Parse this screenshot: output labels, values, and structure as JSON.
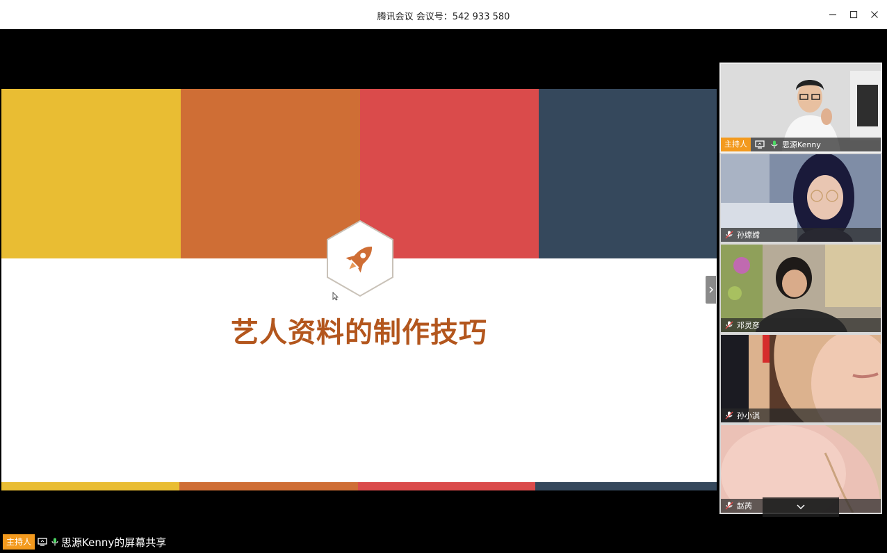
{
  "window": {
    "title": "腾讯会议 会议号：542 933 580",
    "minimize": "—",
    "maximize": "☐",
    "close": "✕"
  },
  "colors": {
    "band1": "#e9bd33",
    "band2": "#cf6e35",
    "band3": "#da4b4b",
    "band4": "#35485c",
    "title_text": "#b3561d",
    "host_badge": "#f39a1e"
  },
  "slide": {
    "title": "艺人资料的制作技巧",
    "icon": "rocket-icon"
  },
  "participants": [
    {
      "name": "思源Kenny",
      "host_badge": "主持人",
      "is_host": true
    },
    {
      "name": "孙嫦嫦",
      "is_host": false
    },
    {
      "name": "邓灵彦",
      "is_host": false
    },
    {
      "name": "孙小淇",
      "is_host": false
    },
    {
      "name": "赵芮",
      "is_host": false
    }
  ],
  "panel": {
    "collapse_icon": "⌄"
  },
  "status": {
    "host_badge": "主持人",
    "text": "思源Kenny的屏幕共享"
  }
}
